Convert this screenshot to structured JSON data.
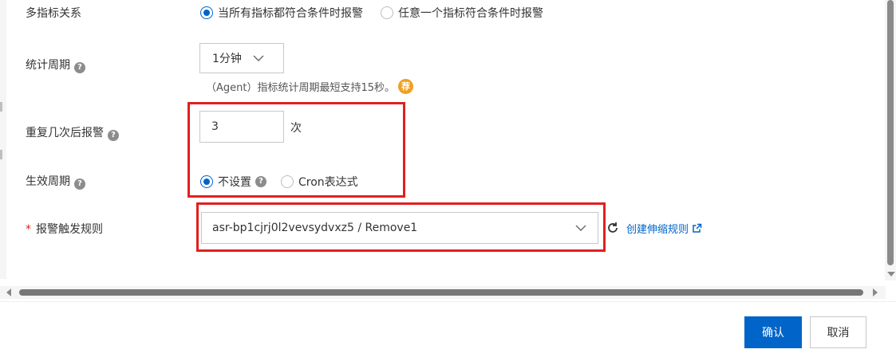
{
  "form": {
    "multi_metric": {
      "label": "多指标关系",
      "options": [
        "当所有指标都符合条件时报警",
        "任意一个指标符合条件时报警"
      ],
      "selected_index": 0
    },
    "period": {
      "label": "统计周期",
      "value": "1分钟",
      "hint": "（Agent）指标统计周期最短支持15秒。",
      "badge": "荐"
    },
    "repeat": {
      "label": "重复几次后报警",
      "value": "3",
      "unit": "次"
    },
    "effective": {
      "label": "生效周期",
      "options": [
        "不设置",
        "Cron表达式"
      ],
      "selected_index": 0
    },
    "trigger_rule": {
      "required_mark": "*",
      "label": "报警触发规则",
      "value": "asr-bp1cjrj0l2vevsydvxz5 / Remove1",
      "link": "创建伸缩规则"
    }
  },
  "footer": {
    "confirm": "确认",
    "cancel": "取消"
  },
  "colors": {
    "primary": "#0064c8",
    "highlight": "#e02020",
    "badge": "#f0a020"
  }
}
